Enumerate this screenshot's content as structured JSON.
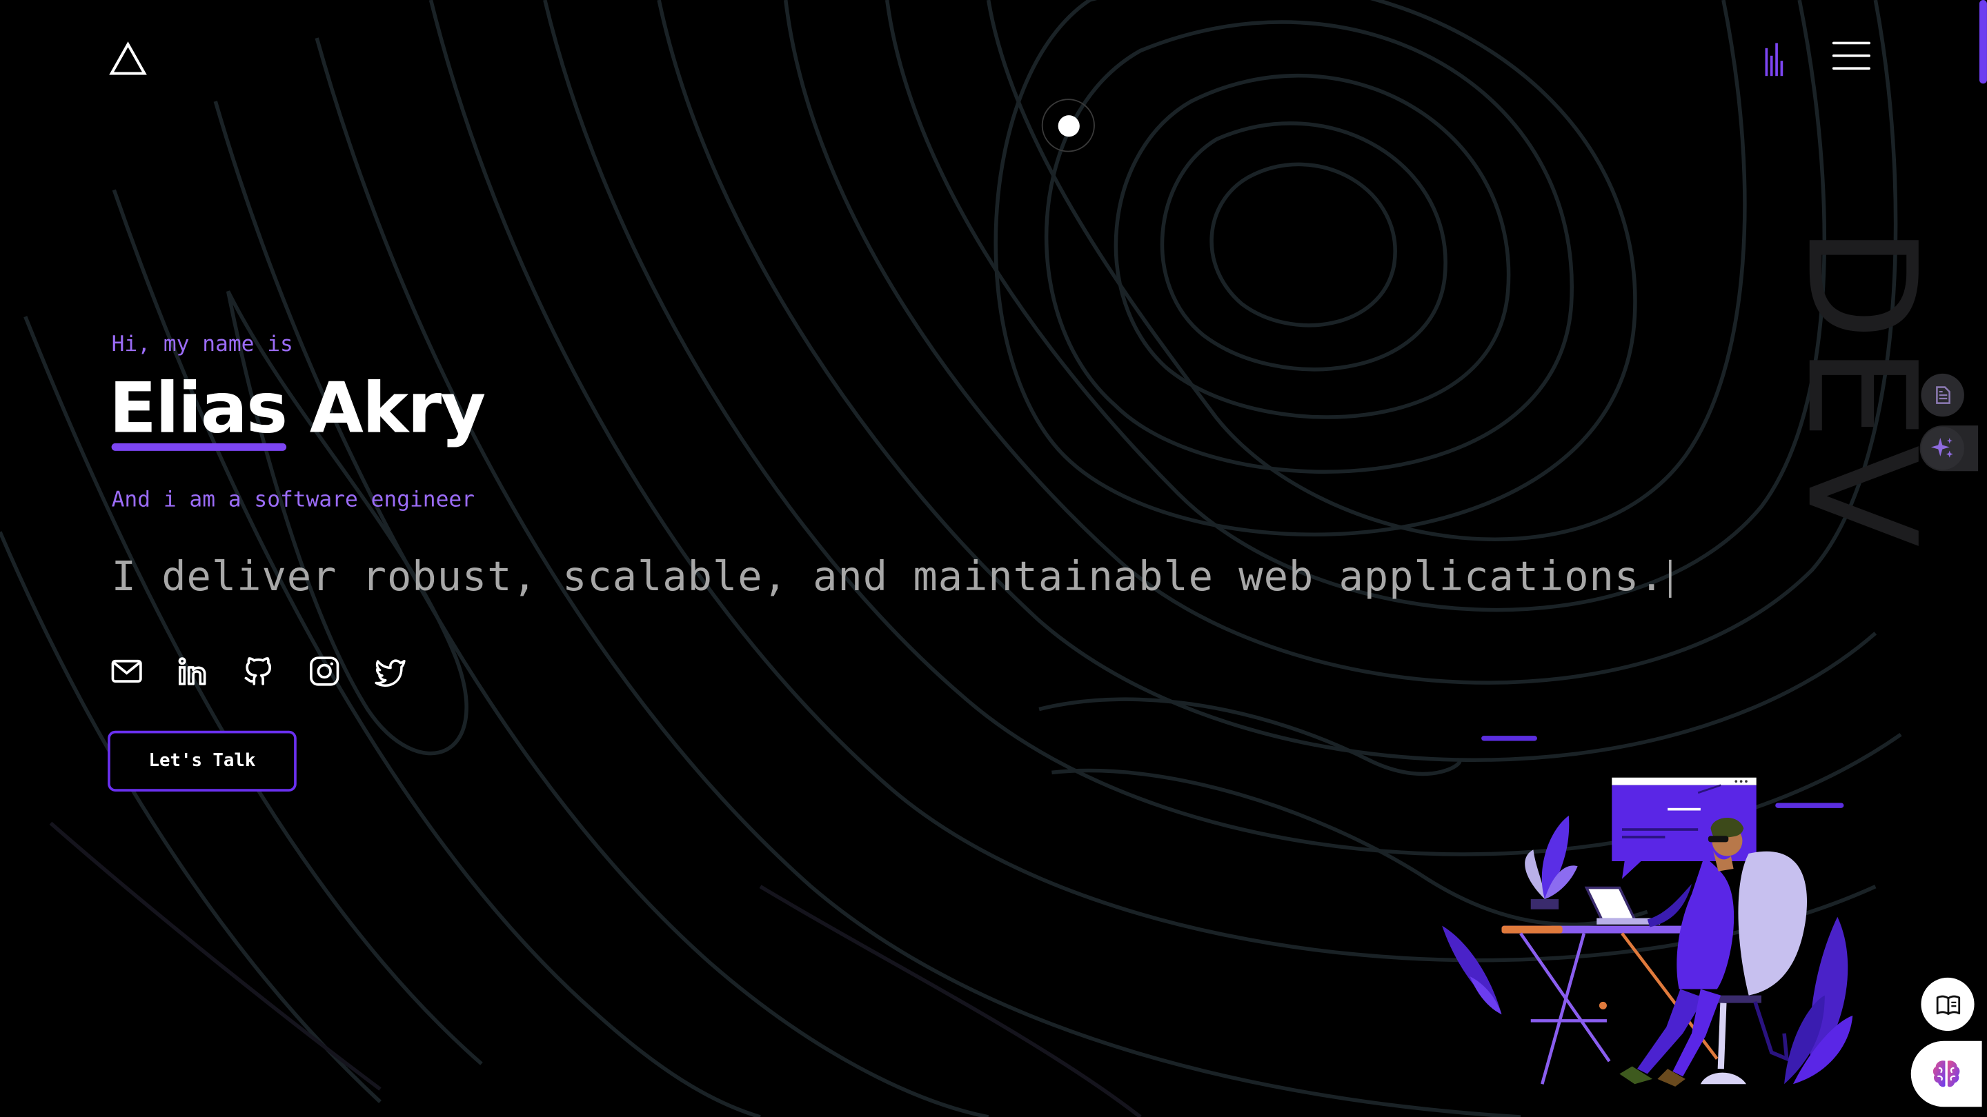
{
  "header": {
    "logo_icon": "triangle-logo-icon",
    "sound_icon": "equalizer-icon",
    "menu_icon": "hamburger-menu-icon"
  },
  "hero": {
    "greeting": "Hi, my name is",
    "first_name": "Elias",
    "last_name": "Akry",
    "role": "And i am a software engineer",
    "tagline": "I deliver robust, scalable, and maintainable web applications.",
    "cta_label": "Let's Talk",
    "watermark": "DEV"
  },
  "socials": [
    {
      "name": "email",
      "icon": "mail-icon"
    },
    {
      "name": "linkedin",
      "icon": "linkedin-icon"
    },
    {
      "name": "github",
      "icon": "github-icon"
    },
    {
      "name": "instagram",
      "icon": "instagram-icon"
    },
    {
      "name": "twitter",
      "icon": "twitter-icon"
    }
  ],
  "floating": {
    "resume_icon": "document-icon",
    "ai_icon": "sparkles-icon",
    "read_icon": "open-book-icon",
    "brain_icon": "brain-icon"
  },
  "colors": {
    "accent": "#7c45f2",
    "accent_text": "#9b6cf7",
    "background": "#000000",
    "text": "#ffffff",
    "muted": "#a8a8a8"
  }
}
